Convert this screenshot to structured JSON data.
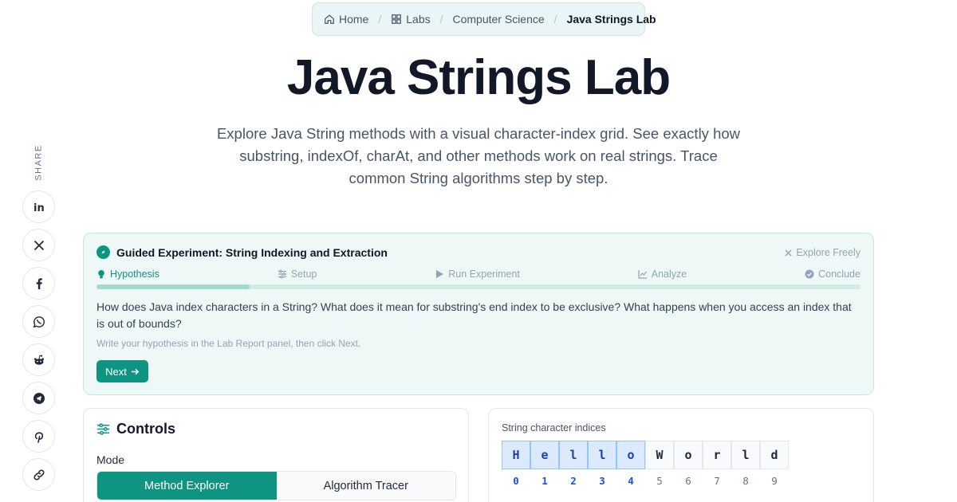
{
  "breadcrumb": {
    "items": [
      {
        "label": "Home",
        "icon": "home-icon"
      },
      {
        "label": "Labs",
        "icon": "grid-icon"
      },
      {
        "label": "Computer Science"
      },
      {
        "label": "Java Strings Lab"
      }
    ]
  },
  "page": {
    "title": "Java Strings Lab",
    "subtitle": "Explore Java String methods with a visual character-index grid. See exactly how substring, indexOf, charAt, and other methods work on real strings. Trace common String algorithms step by step."
  },
  "share": {
    "label": "SHARE",
    "buttons": [
      "linkedin-icon",
      "x-icon",
      "facebook-icon",
      "whatsapp-icon",
      "reddit-icon",
      "telegram-icon",
      "pinterest-icon",
      "link-icon"
    ]
  },
  "guided": {
    "title": "Guided Experiment: String Indexing and Extraction",
    "explore_freely": "Explore Freely",
    "steps": [
      {
        "label": "Hypothesis",
        "active": true
      },
      {
        "label": "Setup",
        "active": false
      },
      {
        "label": "Run Experiment",
        "active": false
      },
      {
        "label": "Analyze",
        "active": false
      },
      {
        "label": "Conclude",
        "active": false
      }
    ],
    "progress": 0.2,
    "question": "How does Java index characters in a String? What does it mean for substring's end index to be exclusive? What happens when you access an index that is out of bounds?",
    "hint": "Write your hypothesis in the Lab Report panel, then click Next.",
    "next_label": "Next",
    "accent": "#0f9482"
  },
  "controls": {
    "title": "Controls",
    "mode_label": "Mode",
    "modes": [
      "Method Explorer",
      "Algorithm Tracer"
    ],
    "active_mode": "Method Explorer"
  },
  "index_grid": {
    "label": "String character indices",
    "chars": [
      "H",
      "e",
      "l",
      "l",
      "o",
      "W",
      "o",
      "r",
      "l",
      "d"
    ],
    "indices": [
      "0",
      "1",
      "2",
      "3",
      "4",
      "5",
      "6",
      "7",
      "8",
      "9"
    ],
    "highlighted": [
      0,
      1,
      2,
      3,
      4
    ]
  }
}
